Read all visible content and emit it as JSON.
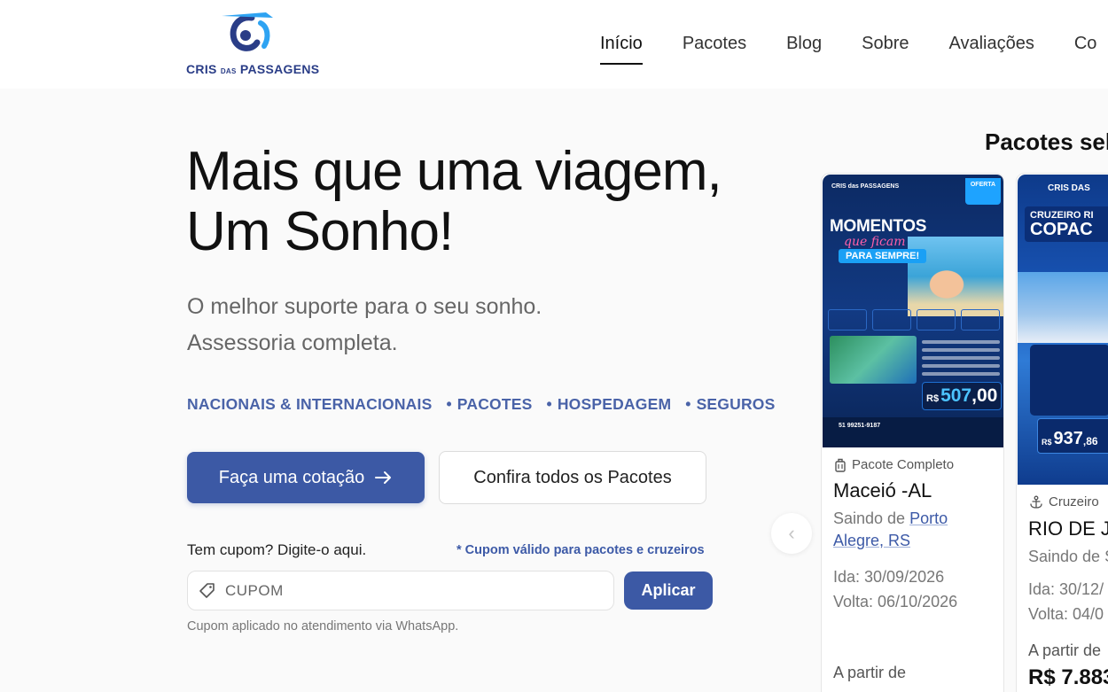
{
  "brand": {
    "logo_line1": "CRIS",
    "logo_small": "DAS",
    "logo_line2": "PASSAGENS",
    "primary_color": "#3c59a5"
  },
  "nav": {
    "items": [
      "Início",
      "Pacotes",
      "Blog",
      "Sobre",
      "Avaliações",
      "Co"
    ]
  },
  "hero": {
    "title": "Mais que uma viagem, Um Sonho!",
    "subtitle_line1": "O melhor suporte para o seu sonho.",
    "subtitle_line2": "Assessoria completa.",
    "tags": [
      "NACIONAIS & INTERNACIONAIS",
      "PACOTES",
      "HOSPEDAGEM",
      "SEGUROS"
    ],
    "cta_primary": "Faça uma cotação",
    "cta_secondary": "Confira todos os Pacotes"
  },
  "coupon": {
    "label": "Tem cupom? Digite-o aqui.",
    "note": "* Cupom válido para pacotes e cruzeiros",
    "placeholder": "CUPOM",
    "apply_label": "Aplicar",
    "hint": "Cupom aplicado no atendimento via WhatsApp."
  },
  "packages": {
    "heading": "Pacotes sel",
    "cards": [
      {
        "poster": {
          "brand": "CRIS das PASSAGENS",
          "offer": "OFERTA",
          "title": "MOMENTOS",
          "script": "que ficam",
          "band": "PARA SEMPRE!",
          "price_currency": "R$",
          "price_int": "507",
          "price_cents": ",00",
          "phone": "51 99251-9187"
        },
        "type": "Pacote Completo",
        "name": "Maceió -AL",
        "from_prefix": "Saindo de ",
        "from_city": "Porto Alegre, RS",
        "departure": "Ida: 30/09/2026",
        "return": "Volta: 06/10/2026",
        "price_prefix": "A partir de"
      },
      {
        "poster": {
          "brand": "CRIS DAS",
          "title_top": "CRUZEIRO RI",
          "title_main": "COPAC",
          "price_currency": "R$",
          "price_int": "937",
          "price_cents": ",86"
        },
        "type": "Cruzeiro",
        "name": "RIO DE JA",
        "from_prefix": "Saindo de S",
        "departure": "Ida: 30/12/",
        "return": "Volta: 04/0",
        "price_prefix": "A partir de",
        "price": "R$ 7.883"
      }
    ]
  }
}
